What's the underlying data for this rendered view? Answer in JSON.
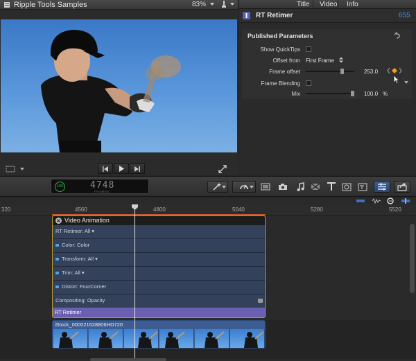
{
  "viewer": {
    "title": "Ripple Tools Samples",
    "zoom": "83%"
  },
  "inspector": {
    "tabs": [
      "Title",
      "Video",
      "Info"
    ],
    "effect_name": "RT Retimer",
    "effect_value": "655",
    "section_title": "Published Parameters",
    "params": {
      "show_quicktips": {
        "label": "Show QuickTips"
      },
      "offset_from": {
        "label": "Offset from",
        "value": "First Frame"
      },
      "frame_offset": {
        "label": "Frame offset",
        "value": "253.0",
        "level": 0.77
      },
      "frame_blending": {
        "label": "Frame Blending"
      },
      "mix": {
        "label": "Mix",
        "value": "100.0",
        "unit": "%",
        "level": 1.0
      }
    }
  },
  "toolbar": {
    "timecode": "4748",
    "timecode_sub": "FRAMES",
    "timecode_badge": "100"
  },
  "timeline": {
    "ruler": [
      "320",
      "4560",
      "4800",
      "5040",
      "5280",
      "5520"
    ],
    "compound_title": "Video Animation",
    "lanes": [
      {
        "label": "RT Retimer: All",
        "dot": false,
        "chevron": true
      },
      {
        "label": "Color: Color",
        "dot": true,
        "chevron": false
      },
      {
        "label": "Transform: All",
        "dot": true,
        "chevron": true
      },
      {
        "label": "Trim: All",
        "dot": true,
        "chevron": true
      },
      {
        "label": "Distort: FourCorner",
        "dot": true,
        "chevron": false
      },
      {
        "label": "Compositing: Opacity",
        "dot": false,
        "chevron": false
      }
    ],
    "effect_bar": "RT Retimer",
    "clip_name": "iStock_000021628806HD720"
  },
  "colors": {
    "accent_blue": "#3f6fc2",
    "effect_bar": "#6a5fb0",
    "selection_yellow": "#c9a93a",
    "keyframe_orange": "#f0a020"
  }
}
